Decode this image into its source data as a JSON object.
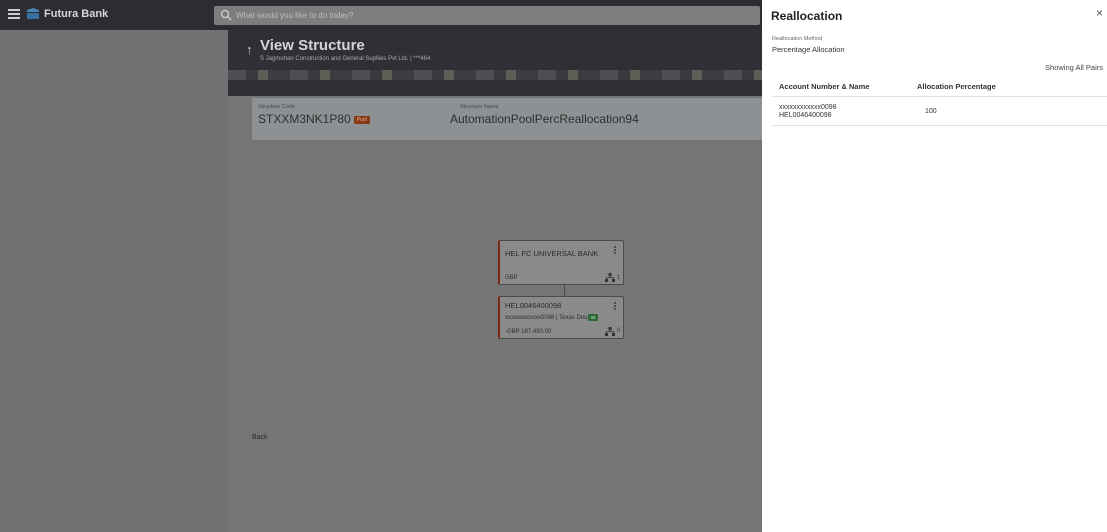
{
  "header": {
    "brand": "Futura Bank",
    "search_placeholder": "What would you like to do today?",
    "icons": [
      "hamburger-menu-icon",
      "bank-logo-icon",
      "search-icon"
    ]
  },
  "page": {
    "title": "View Structure",
    "subtitle": "S Jagmohan Construction and General Supllies Pvt Ltd. | ***464",
    "structure_code_label": "Structure Code",
    "structure_code": "STXXM3NK1P80",
    "structure_type_badge": "Pool",
    "structure_name_label": "Structure Name",
    "structure_name": "AutomationPoolPercReallocation94",
    "back_label": "Back"
  },
  "tree": {
    "root": {
      "title": "HEL FC UNIVERSAL BANK",
      "currency": "GBP",
      "child_count": "1"
    },
    "child": {
      "title": "HEL0046400098",
      "account": "xxxxxxxxxxxx0098 | Texas Dou",
      "badge": "Int",
      "balance": "-GBP 187,490.00",
      "child_count": "0"
    }
  },
  "panel": {
    "title": "Reallocation",
    "close": "×",
    "method_label": "Reallocation Method",
    "method_value": "Percentage Allocation",
    "showing": "Showing All Pairs",
    "columns": [
      "Account Number & Name",
      "Allocation Percentage"
    ],
    "rows": [
      {
        "account_number": "xxxxxxxxxxxx0098",
        "account_name": "HEL0046400098",
        "percentage": "100"
      }
    ]
  },
  "colors": {
    "header_bg": "#2b2d33",
    "overlay_grey": "#757575",
    "pool_badge": "#8b3a17",
    "internal_badge": "#2d6a36",
    "node_accent": "#7a2a12"
  }
}
